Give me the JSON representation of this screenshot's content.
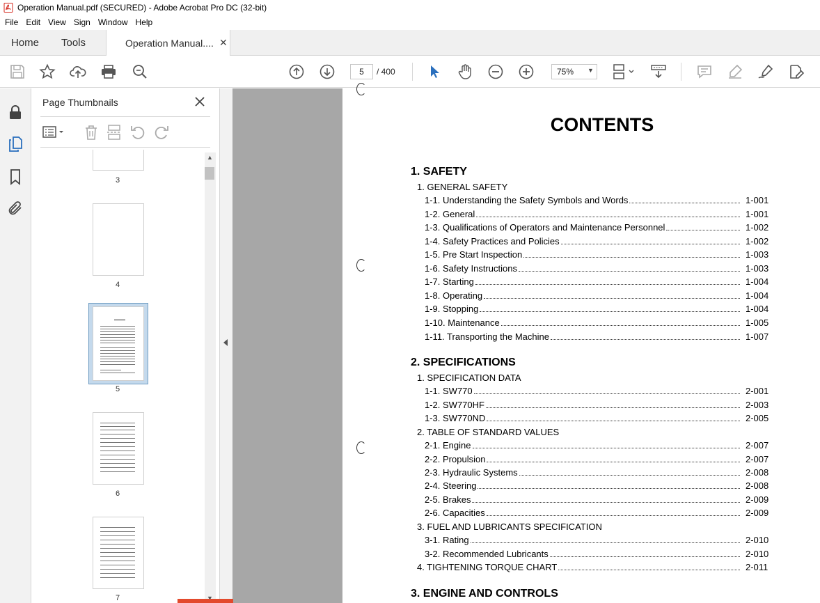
{
  "window": {
    "title": "Operation Manual.pdf (SECURED) - Adobe Acrobat Pro DC (32-bit)"
  },
  "menu": [
    "File",
    "Edit",
    "View",
    "Sign",
    "Window",
    "Help"
  ],
  "tabs": {
    "home": "Home",
    "tools": "Tools",
    "document": "Operation Manual...."
  },
  "toolbar": {
    "page_current": "5",
    "page_total": "/ 400",
    "zoom": "75%"
  },
  "panel": {
    "title": "Page Thumbnails"
  },
  "thumbnails": [
    {
      "num": "3"
    },
    {
      "num": "4"
    },
    {
      "num": "5",
      "selected": true
    },
    {
      "num": "6"
    },
    {
      "num": "7"
    }
  ],
  "document": {
    "heading": "CONTENTS",
    "sections": [
      {
        "title": "1. SAFETY"
      },
      {
        "title": "2. SPECIFICATIONS"
      },
      {
        "title": "3. ENGINE AND CONTROLS"
      }
    ],
    "subsections": [
      "1. GENERAL SAFETY",
      "1. SPECIFICATION DATA",
      "2. TABLE OF STANDARD VALUES",
      "3. FUEL AND LUBRICANTS SPECIFICATION"
    ],
    "torque_entry": {
      "title": "4. TIGHTENING TORQUE CHART",
      "page": "2-011"
    },
    "entries": [
      {
        "title": "1-1. Understanding the Safety Symbols and Words",
        "page": "1-001"
      },
      {
        "title": "1-2. General",
        "page": "1-001"
      },
      {
        "title": "1-3. Qualifications of Operators and Maintenance Personnel",
        "page": "1-002"
      },
      {
        "title": "1-4. Safety Practices and Policies",
        "page": "1-002"
      },
      {
        "title": "1-5. Pre Start Inspection",
        "page": "1-003"
      },
      {
        "title": "1-6. Safety Instructions",
        "page": "1-003"
      },
      {
        "title": "1-7. Starting",
        "page": "1-004"
      },
      {
        "title": "1-8. Operating",
        "page": "1-004"
      },
      {
        "title": "1-9. Stopping",
        "page": "1-004"
      },
      {
        "title": "1-10. Maintenance",
        "page": "1-005"
      },
      {
        "title": "1-11. Transporting the Machine",
        "page": "1-007"
      },
      {
        "title": "1-1. SW770",
        "page": "2-001"
      },
      {
        "title": "1-2. SW770HF",
        "page": "2-003"
      },
      {
        "title": "1-3. SW770ND",
        "page": "2-005"
      },
      {
        "title": "2-1. Engine",
        "page": "2-007"
      },
      {
        "title": "2-2. Propulsion",
        "page": "2-007"
      },
      {
        "title": "2-3. Hydraulic Systems",
        "page": "2-008"
      },
      {
        "title": "2-4. Steering",
        "page": "2-008"
      },
      {
        "title": "2-5. Brakes",
        "page": "2-009"
      },
      {
        "title": "2-6. Capacities",
        "page": "2-009"
      },
      {
        "title": "3-1. Rating",
        "page": "2-010"
      },
      {
        "title": "3-2. Recommended Lubricants",
        "page": "2-010"
      }
    ]
  }
}
